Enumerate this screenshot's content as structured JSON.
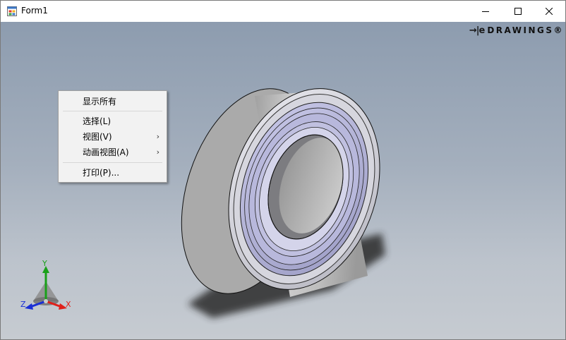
{
  "window": {
    "title": "Form1",
    "icon": "winforms-app-icon",
    "controls": {
      "minimize": "—",
      "maximize": "☐",
      "close": "✕"
    }
  },
  "viewer": {
    "brand_mark": "→|e",
    "brand_text": "DRAWINGS®",
    "triad_labels": {
      "x": "X",
      "y": "Y",
      "z": "Z"
    },
    "triad_colors": {
      "x": "#e0201a",
      "y": "#19a019",
      "z": "#1a2fd6"
    },
    "background_top": "#8d9caf",
    "background_bottom": "#c6cbd1"
  },
  "context_menu": {
    "items": [
      {
        "label": "显示所有",
        "submenu": false
      },
      {
        "label": "选择(L)",
        "submenu": false
      },
      {
        "label": "视图(V)",
        "submenu": true
      },
      {
        "label": "动画视图(A)",
        "submenu": true
      },
      {
        "label": "打印(P)...",
        "submenu": false
      }
    ],
    "submenu_arrow": "›"
  }
}
